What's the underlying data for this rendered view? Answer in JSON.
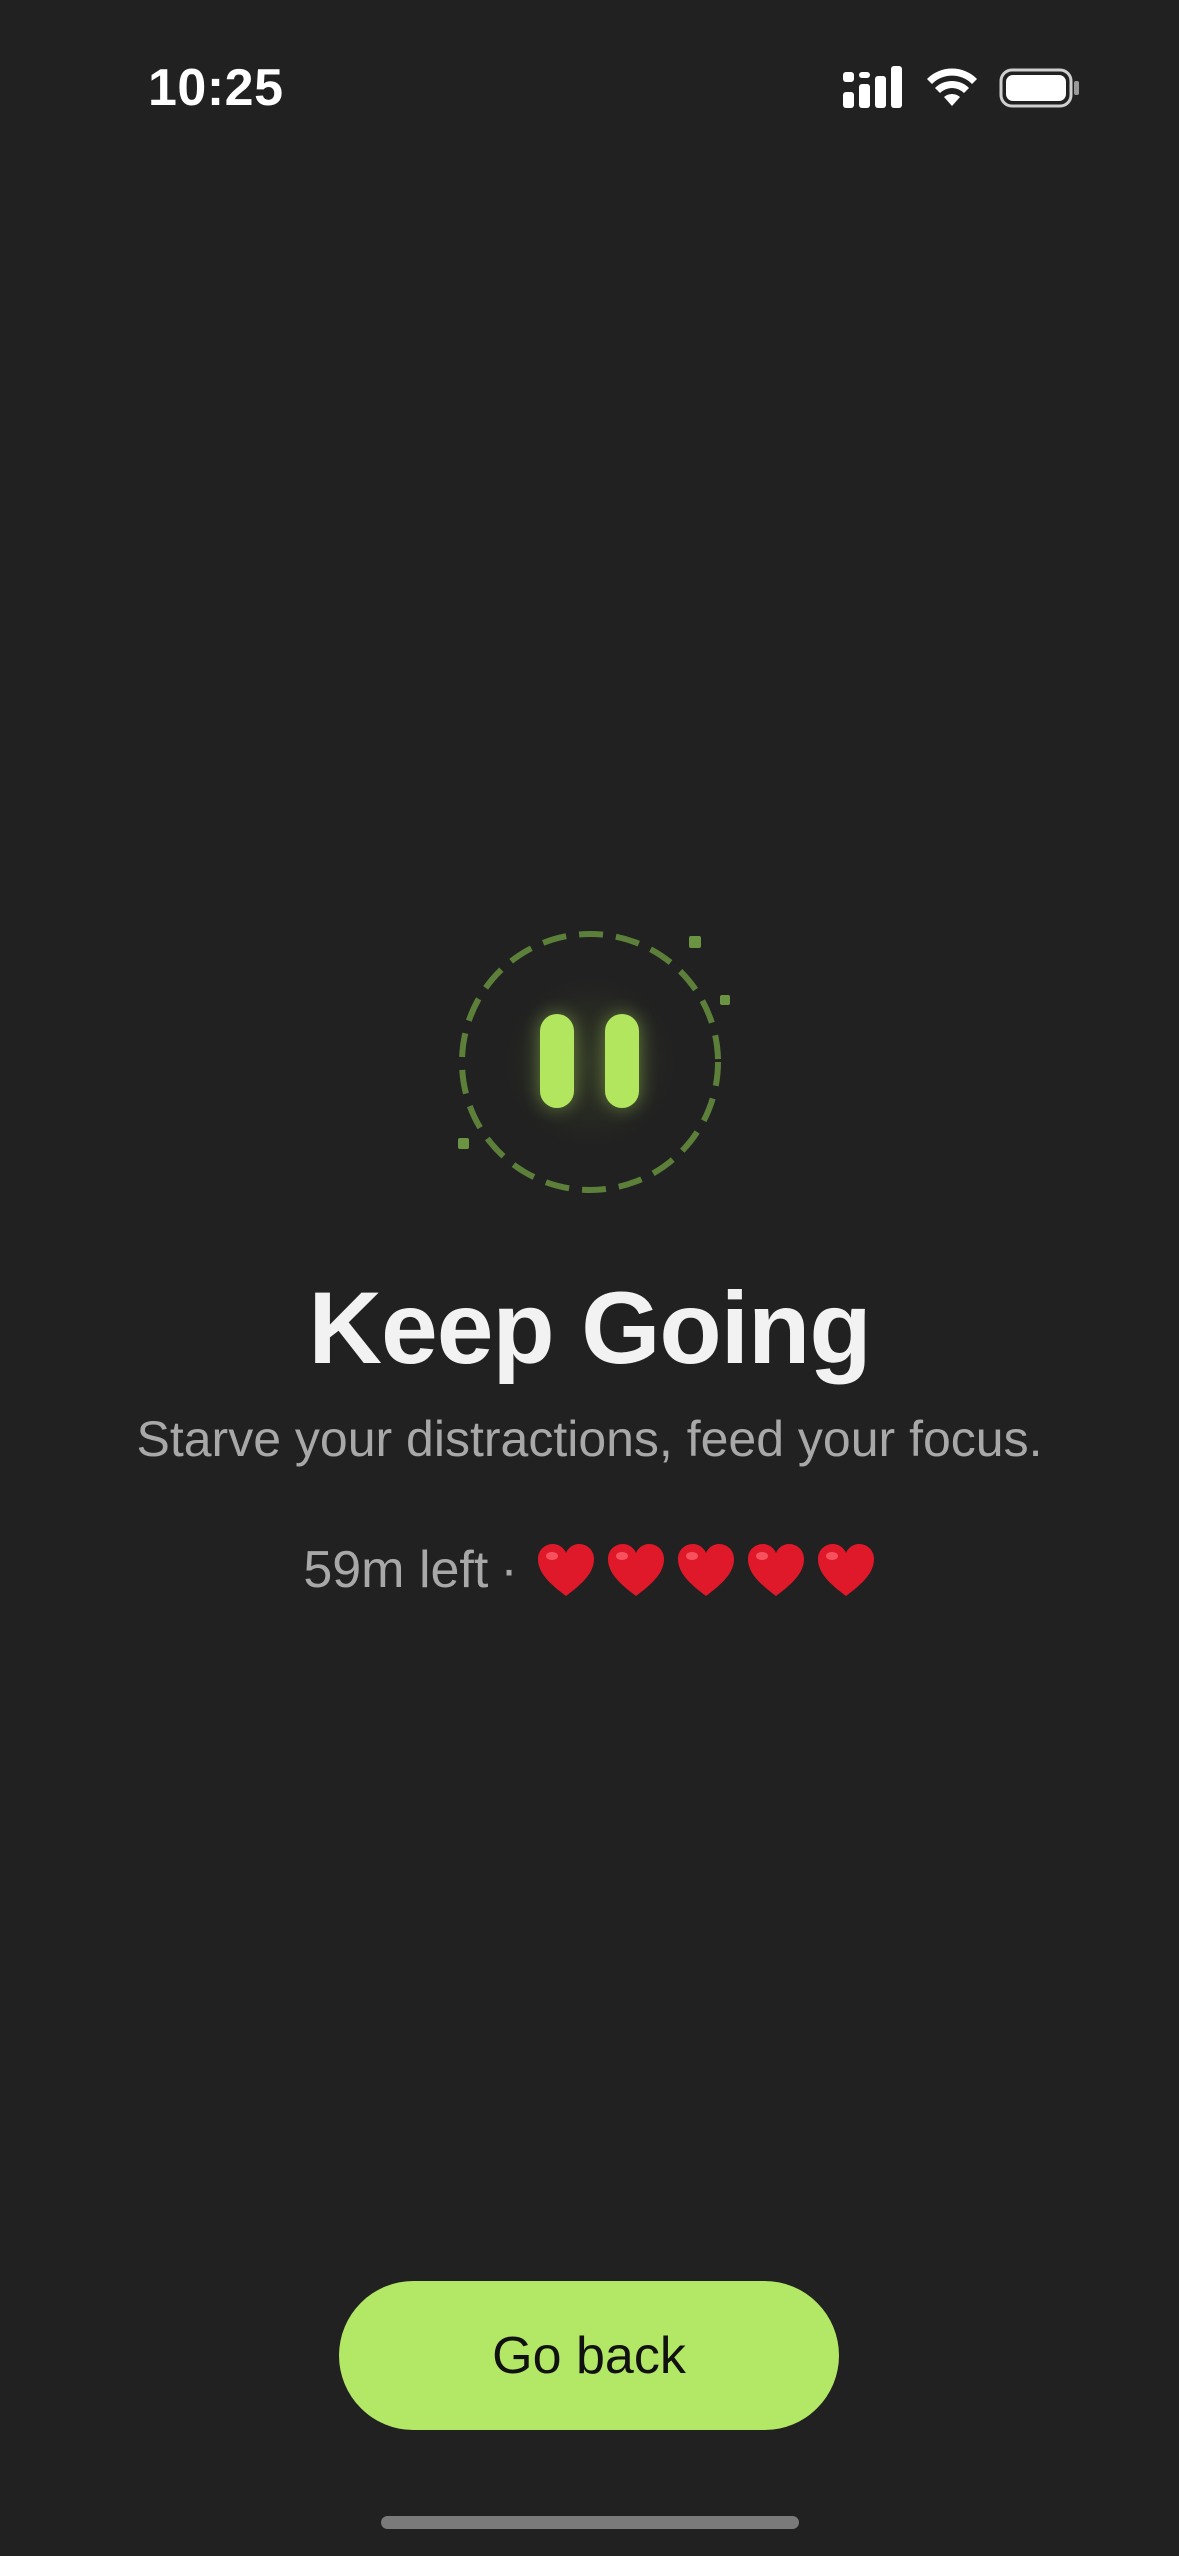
{
  "status_bar": {
    "time": "10:25",
    "icons": [
      "cellular-signal-icon",
      "wifi-icon",
      "battery-icon"
    ]
  },
  "focus": {
    "icon": "pause-icon",
    "title": "Keep Going",
    "subtitle": "Starve your distractions, feed your focus.",
    "time_left": "59m left",
    "separator": "·",
    "hearts_count": 5
  },
  "actions": {
    "go_back_label": "Go back"
  },
  "colors": {
    "background": "#212121",
    "accent": "#b3e866",
    "text_primary": "#f2f2f2",
    "text_secondary": "#a8a8a8",
    "heart": "#e0192a"
  }
}
